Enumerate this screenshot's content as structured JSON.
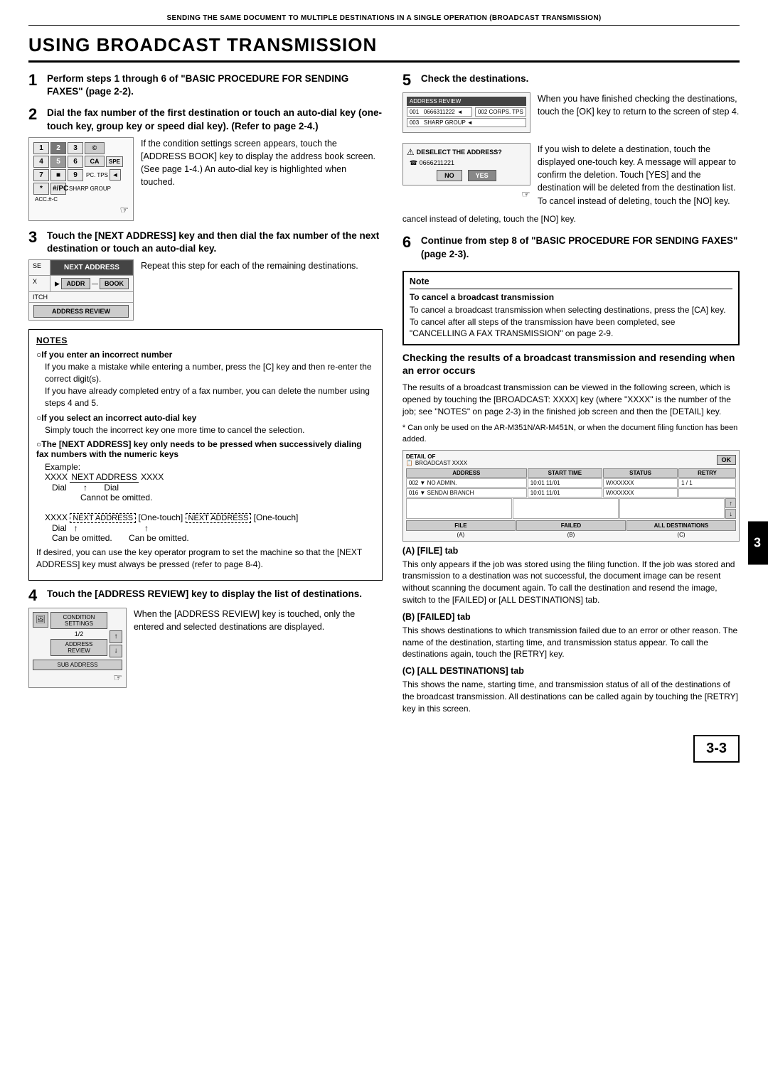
{
  "header": {
    "text": "SENDING THE SAME DOCUMENT TO MULTIPLE DESTINATIONS IN A SINGLE OPERATION (BROADCAST TRANSMISSION)"
  },
  "page_title": "USING BROADCAST TRANSMISSION",
  "steps": {
    "step1": {
      "num": "1",
      "text": "Perform steps 1 through 6 of \"BASIC PROCEDURE FOR SENDING FAXES\" (page 2-2)."
    },
    "step2": {
      "num": "2",
      "text": "Dial the fax number of the first destination or touch an auto-dial key (one-touch key,  group key or speed dial key). (Refer to page 2-4.)"
    },
    "step2_body": "If the condition settings screen appears, touch the [ADDRESS BOOK] key to display the address book screen. (See page 1-4.) An auto-dial key is highlighted when touched.",
    "step3": {
      "num": "3",
      "text": "Touch the [NEXT ADDRESS] key and then dial the fax number of the next destination or touch an auto-dial key."
    },
    "step3_body": "Repeat this step for each of the remaining destinations.",
    "step4": {
      "num": "4",
      "text": "Touch the [ADDRESS REVIEW] key to display the list of destinations."
    },
    "step4_body": "When the [ADDRESS REVIEW] key is touched, only the entered and selected destinations are displayed.",
    "step5": {
      "num": "5",
      "text": "Check the destinations."
    },
    "step5_body": "When you have finished checking the destinations, touch the [OK] key to return to the screen of step 4.",
    "step5_body2": "If you wish to delete a destination, touch the displayed one-touch key. A message will appear to confirm the deletion. Touch [YES] and the destination will be deleted from the destination list. To cancel instead of deleting, touch the [NO] key.",
    "step6": {
      "num": "6",
      "text": "Continue from step 8 of \"BASIC PROCEDURE FOR SENDING FAXES\" (page  2-3)."
    }
  },
  "notes": {
    "title": "NOTES",
    "items": [
      {
        "header": "○If you enter an incorrect number",
        "lines": [
          "If you make a mistake while entering a number, press the [C] key and then re-enter the correct digit(s).",
          "If you have already completed entry of a fax number, you can delete the number using steps 4 and 5."
        ]
      },
      {
        "header": "○If you select an incorrect auto-dial key",
        "lines": [
          "Simply touch the incorrect key one more time to cancel the selection."
        ]
      },
      {
        "header": "○The [NEXT ADDRESS] key only needs to be pressed when successively dialing fax numbers with the numeric keys",
        "lines": []
      },
      {
        "example_label": "Example:",
        "example_line1": "XXXX [NEXT ADDRESS] XXXX",
        "example_line1_sub": "Dial          ↑          Dial",
        "example_line1_note": "Cannot be omitted.",
        "example_line2": "XXXX [NEXT ADDRESS] [One-touch] [NEXT ADDRESS] [One-touch]",
        "example_line2_sub": "Dial    ↑                              ↑",
        "example_line2_note": "Can be omitted.        Can be omitted."
      },
      {
        "lines": [
          "If desired, you can use the key operator program to set the machine so that the [NEXT ADDRESS] key must always be pressed (refer to page 8-4)."
        ]
      }
    ]
  },
  "broadcast_check": {
    "title": "Checking the results of a broadcast transmission and resending when an error occurs",
    "body": "The results of a broadcast transmission can be viewed in the following screen, which is opened by touching the [BROADCAST: XXXX] key (where \"XXXX\" is the number of the job; see \"NOTES\" on page 2-3) in the finished job screen and then the [DETAIL] key.",
    "note": "* Can only be used on the AR-M351N/AR-M451N, or when the document filing function has been added.",
    "detail_screen": {
      "title": "DETAIL OF",
      "subtitle": "BROADCAST XXXX",
      "ok_btn": "OK",
      "columns": [
        "ADDRESS",
        "START TIME",
        "STATUS",
        "RETRY"
      ],
      "rows": [
        {
          "addr": "002 ▼ NO ADMIN.",
          "time": "10:01  11/01",
          "status": "WXXXXXX",
          "retry": "1 / 1"
        },
        {
          "addr": "016 ▼ SENDAI BRANCH",
          "time": "10:01  11/01",
          "status": "WXXXXXX",
          "retry": ""
        }
      ],
      "tabs": [
        "FILE",
        "FAILED",
        "ALL DESTINATIONS"
      ],
      "tab_labels": [
        "(A)",
        "(B)",
        "(C)"
      ]
    }
  },
  "list_items": {
    "a_label": "(A)  [FILE] tab",
    "a_body": "This only appears if the job was stored using the filing function. If the job was stored and transmission to a destination was not successful, the document image can be resent without scanning the document again. To call the destination and resend the image, switch to the [FAILED] or  [ALL DESTINATIONS] tab.",
    "b_label": "(B)  [FAILED] tab",
    "b_body": "This shows destinations to which transmission failed due to an error or other reason. The name of the destination, starting time, and transmission status appear. To call the destinations again, touch the [RETRY] key.",
    "c_label": "(C)  [ALL DESTINATIONS] tab",
    "c_body": "This shows the name, starting time, and transmission status of all of the destinations of the broadcast transmission. All destinations can be called again by touching the [RETRY] key in this screen."
  },
  "note_cancel": {
    "title": "Note",
    "subtitle": "To cancel a broadcast transmission",
    "body": "To cancel a broadcast transmission when selecting destinations, press the [CA] key. To cancel after all steps of the transmission have been completed, see \"CANCELLING A FAX TRANSMISSION\" on page 2-9."
  },
  "panel": {
    "next_address": "NEXT ADDRESS",
    "addr_book": "ADDR    BOOK",
    "address_review": "ADDRESS REVIEW",
    "se_label": "SE",
    "x_label": "X",
    "itch_label": "ITCH"
  },
  "addr_review_panel": {
    "condition_settings": "CONDITION\nSETTINGS",
    "address_review": "ADDRESS REVIEW",
    "sub_address": "SUB ADDRESS",
    "page_num": "1/2"
  },
  "dest_screen": {
    "title": "ADDRESS REVIEW",
    "rows": [
      {
        "num": "001",
        "val": "0666311222",
        "extra": "002 CORPS. TPS"
      },
      {
        "num": "003",
        "val": "SHARP GROUP"
      }
    ]
  },
  "delete_confirm": {
    "title": "DESELECT THE ADDRESS?",
    "number": "☎0666211221",
    "no_btn": "NO",
    "yes_btn": "YES"
  },
  "keypad": {
    "keys": [
      "1",
      "2",
      "3",
      "",
      "4",
      "5",
      "6",
      "",
      "7",
      "",
      "9",
      ""
    ],
    "bottom_keys": [
      "*",
      "#/PC.",
      "TPS",
      ""
    ]
  },
  "page_number": "3-3",
  "side_tab": "3"
}
